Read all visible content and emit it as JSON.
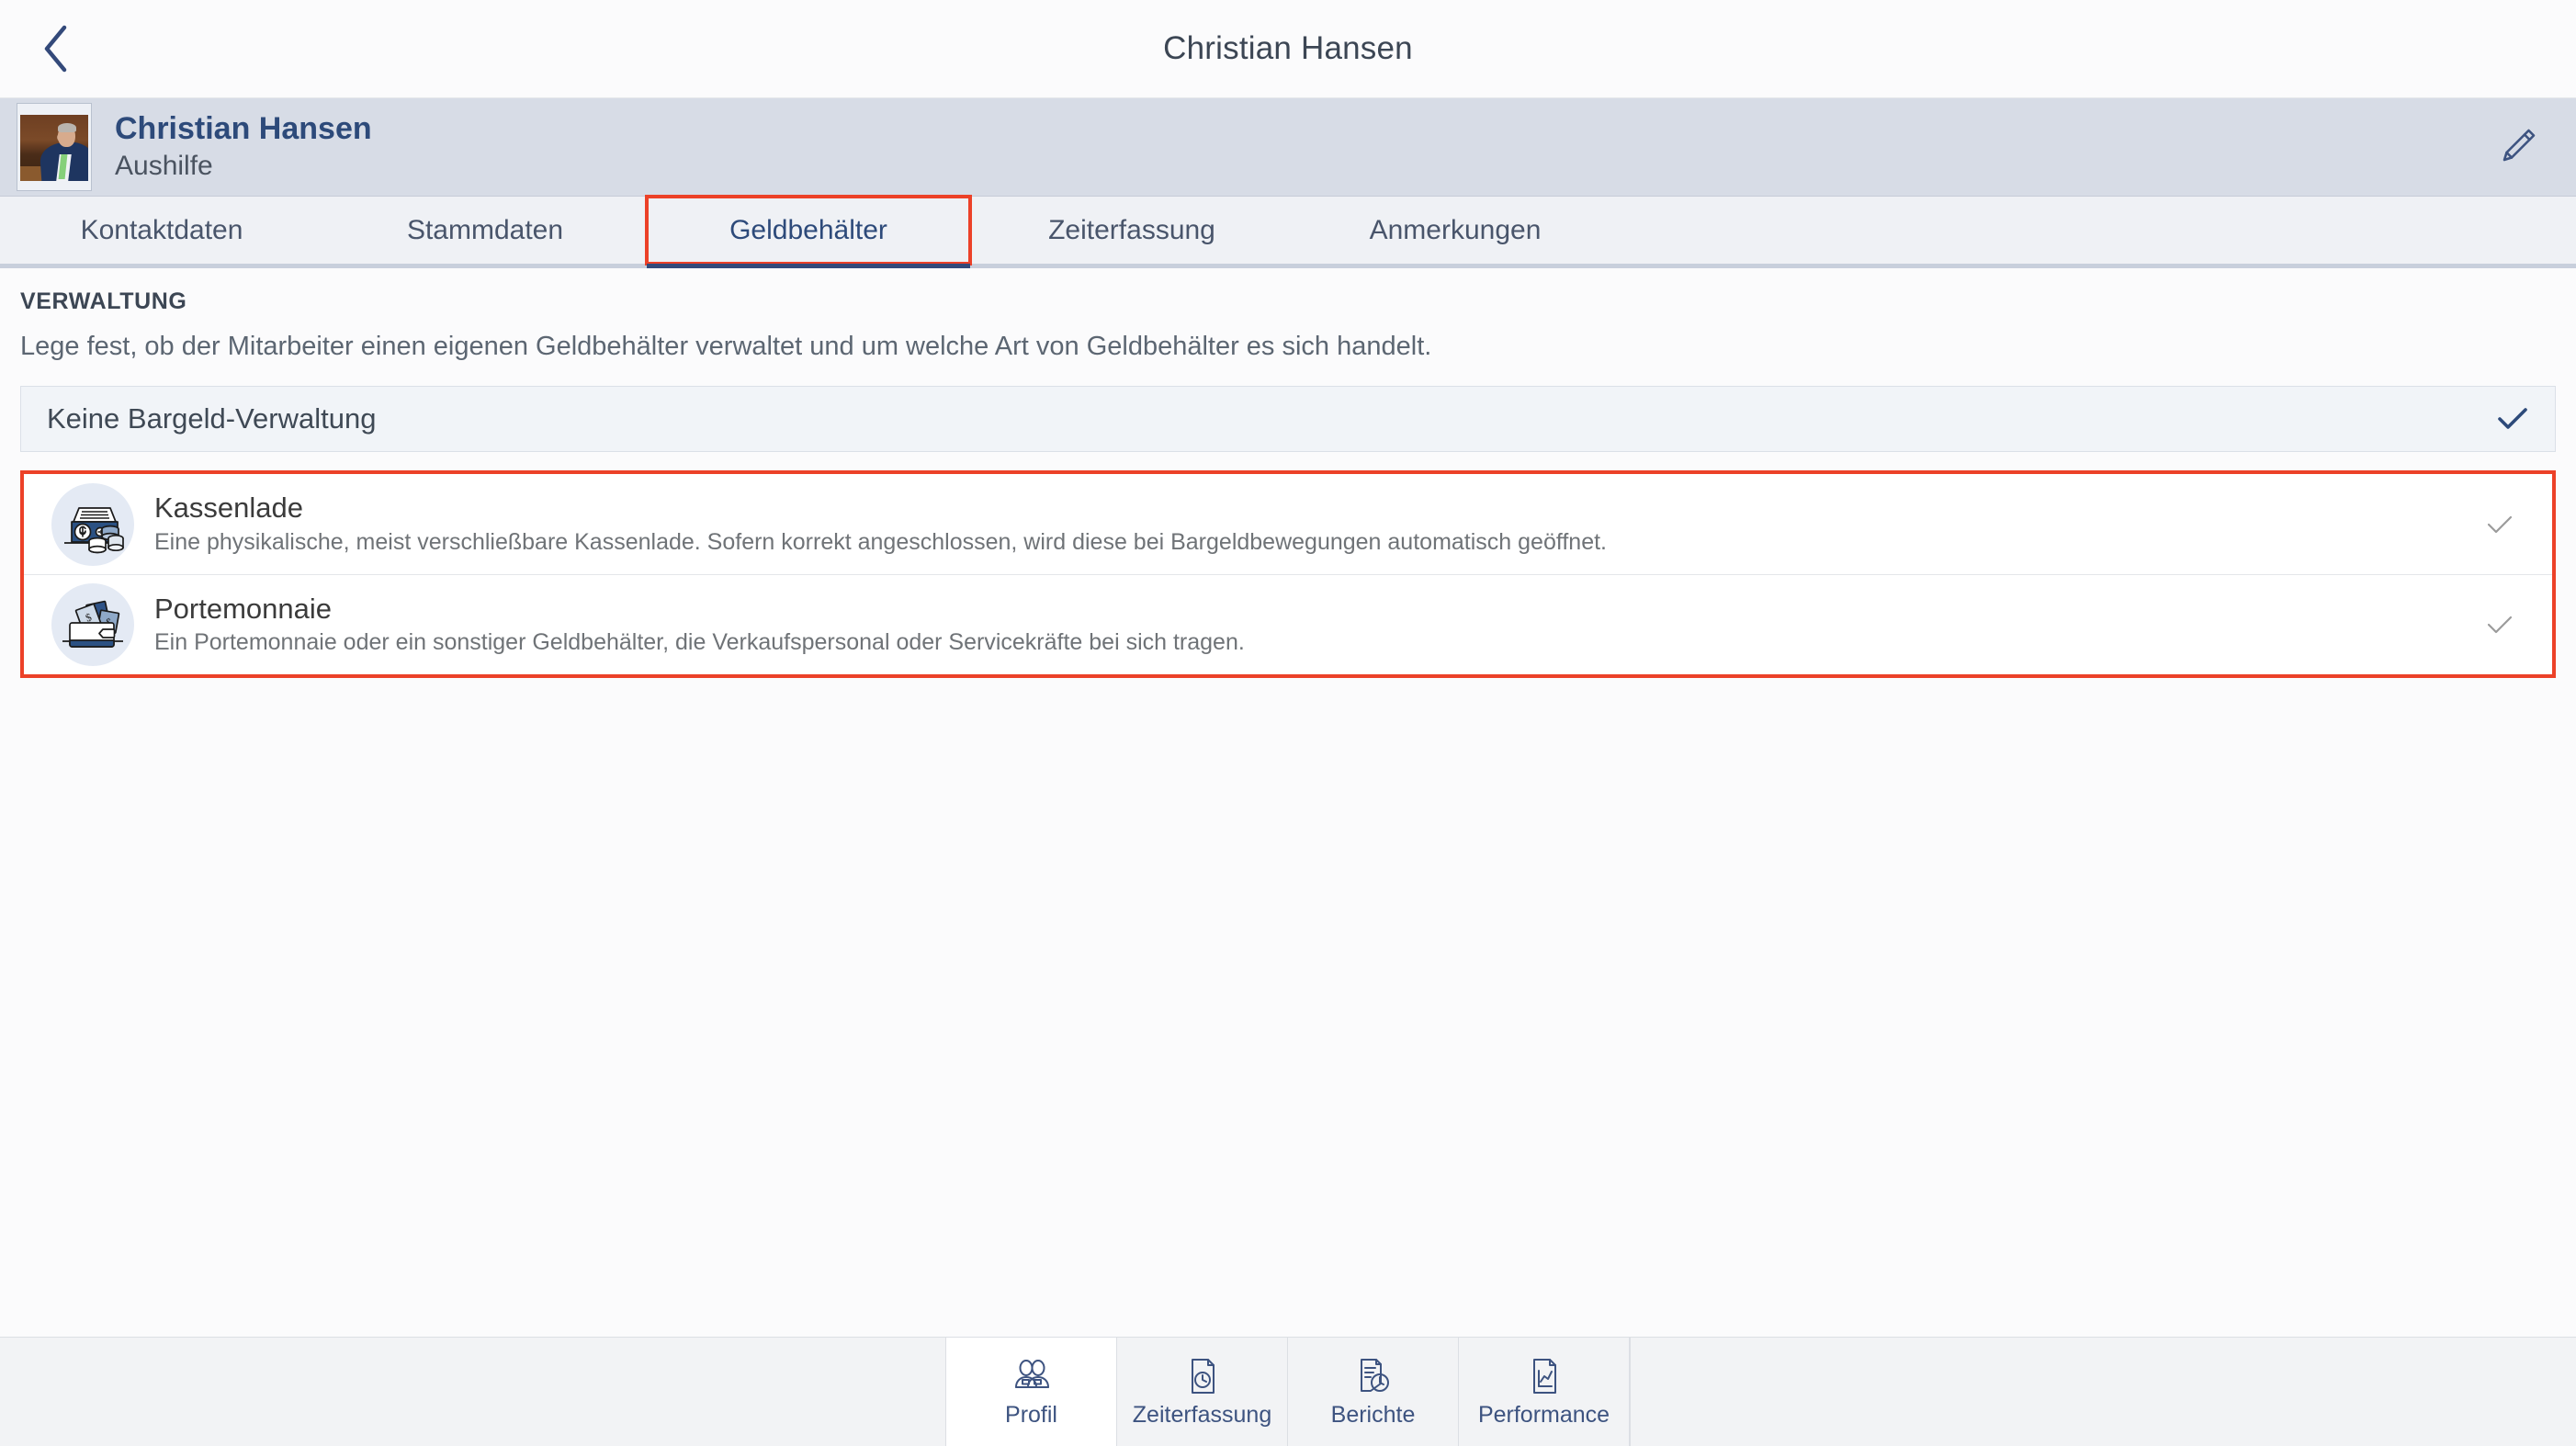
{
  "topbar": {
    "title": "Christian Hansen",
    "back_icon": "chevron-left-icon"
  },
  "profile": {
    "name": "Christian Hansen",
    "role": "Aushilfe",
    "edit_icon": "pencil-icon",
    "avatar_alt": "Christian Hansen"
  },
  "tabs": [
    {
      "label": "Kontaktdaten",
      "active": false,
      "highlighted": false
    },
    {
      "label": "Stammdaten",
      "active": false,
      "highlighted": false
    },
    {
      "label": "Geldbehälter",
      "active": true,
      "highlighted": true
    },
    {
      "label": "Zeiterfassung",
      "active": false,
      "highlighted": false
    },
    {
      "label": "Anmerkungen",
      "active": false,
      "highlighted": false
    }
  ],
  "section": {
    "title": "VERWALTUNG",
    "description": "Lege fest, ob der Mitarbeiter einen eigenen Geldbehälter verwaltet und um welche Art von Geldbehälter es sich handelt."
  },
  "none_option": {
    "label": "Keine Bargeld-Verwaltung",
    "selected": true,
    "check_icon": "check-icon"
  },
  "options": [
    {
      "title": "Kassenlade",
      "description": "Eine physikalische, meist verschließbare Kassenlade. Sofern korrekt angeschlossen, wird diese bei Bargeldbewegungen automatisch geöffnet.",
      "icon": "cash-drawer-icon",
      "selected": false,
      "check_icon": "check-icon"
    },
    {
      "title": "Portemonnaie",
      "description": "Ein Portemonnaie oder ein sonstiger Geldbehälter, die Verkaufspersonal oder Servicekräfte bei sich tragen.",
      "icon": "wallet-icon",
      "selected": false,
      "check_icon": "check-icon"
    }
  ],
  "bottom_nav": [
    {
      "label": "Profil",
      "icon": "people-icon",
      "active": true
    },
    {
      "label": "Zeiterfassung",
      "icon": "document-clock-icon",
      "active": false
    },
    {
      "label": "Berichte",
      "icon": "report-clock-icon",
      "active": false
    },
    {
      "label": "Performance",
      "icon": "document-chart-icon",
      "active": false
    }
  ],
  "colors": {
    "accent_blue": "#2d4a7a",
    "highlight_red": "#ec4128",
    "header_band": "#d7dce6",
    "tab_bar": "#eff1f5",
    "active_underline": "#33497a"
  }
}
